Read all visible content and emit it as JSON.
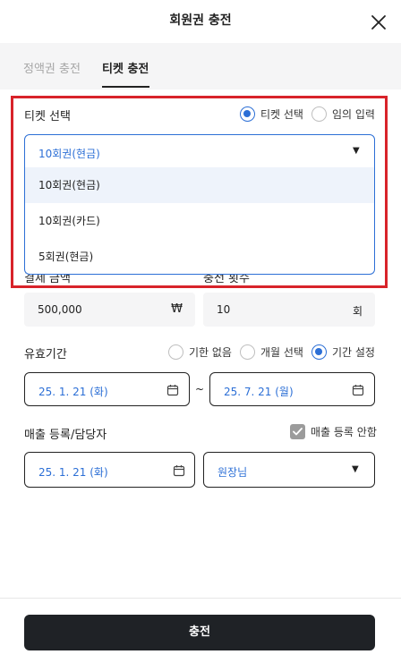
{
  "header": {
    "title": "회원권 충전"
  },
  "tabs": [
    {
      "label": "정액권 충전",
      "active": false
    },
    {
      "label": "티켓 충전",
      "active": true
    }
  ],
  "ticket": {
    "label": "티켓 선택",
    "radio_options": [
      {
        "label": "티켓 선택",
        "selected": true
      },
      {
        "label": "임의 입력",
        "selected": false
      }
    ],
    "selected_value": "10회권(현금)",
    "dropdown_options": [
      "10회권(현금)",
      "10회권(카드)",
      "5회권(현금)"
    ]
  },
  "payment": {
    "amount_label": "결제 금액",
    "amount_value": "500,000",
    "amount_unit": "₩",
    "count_label": "충전 횟수",
    "count_value": "10",
    "count_unit": "회"
  },
  "validity": {
    "label": "유효기간",
    "radio_options": [
      {
        "label": "기한 없음",
        "selected": false
      },
      {
        "label": "개월 선택",
        "selected": false
      },
      {
        "label": "기간 설정",
        "selected": true
      }
    ],
    "start_date": "25. 1. 21 (화)",
    "separator": "~",
    "end_date": "25. 7. 21 (월)"
  },
  "sales": {
    "label": "매출 등록/담당자",
    "no_register_label": "매출 등록 안함",
    "no_register_checked": true,
    "date": "25. 1. 21 (화)",
    "staff": "원장님"
  },
  "submit": {
    "label": "충전"
  },
  "colors": {
    "accent": "#2c6fd6",
    "highlight_frame": "#d8232a",
    "button": "#1f2226"
  }
}
